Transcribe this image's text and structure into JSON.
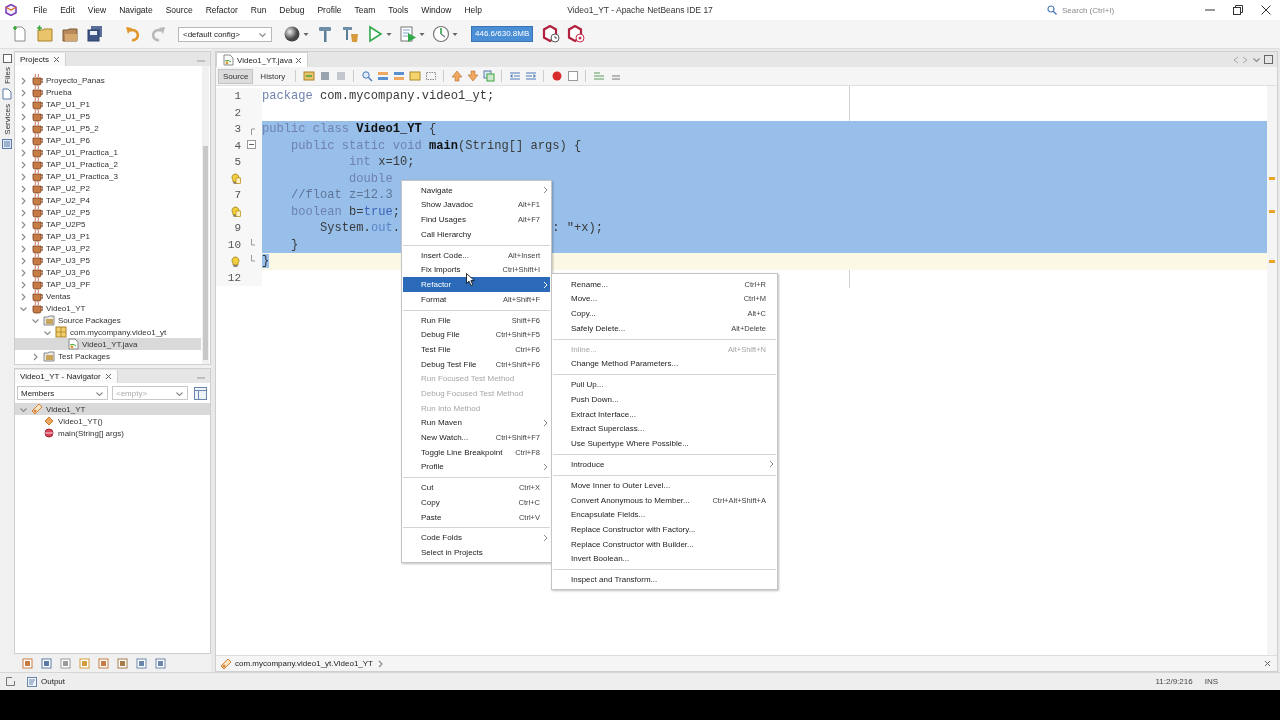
{
  "window": {
    "title": "Video1_YT - Apache NetBeans IDE 17",
    "search": {
      "placeholder": "Search (Ctrl+I)"
    }
  },
  "menu_bar": [
    "File",
    "Edit",
    "View",
    "Navigate",
    "Source",
    "Refactor",
    "Run",
    "Debug",
    "Profile",
    "Team",
    "Tools",
    "Window",
    "Help"
  ],
  "toolbar": {
    "config": "<default config>",
    "memory": "446.6/630.8MB"
  },
  "side_strip": [
    "Files",
    "Services"
  ],
  "projects": {
    "title": "Projects",
    "items": [
      {
        "label": "Proyecto_Panas",
        "kind": "project",
        "expanded": false,
        "selected": false
      },
      {
        "label": "Prueba",
        "kind": "project",
        "expanded": false,
        "selected": false
      },
      {
        "label": "TAP_U1_P1",
        "kind": "project",
        "expanded": false,
        "selected": false
      },
      {
        "label": "TAP_U1_P5",
        "kind": "project",
        "expanded": false,
        "selected": false
      },
      {
        "label": "TAP_U1_P5_2",
        "kind": "project",
        "expanded": false,
        "selected": false
      },
      {
        "label": "TAP_U1_P6",
        "kind": "project",
        "expanded": false,
        "selected": false
      },
      {
        "label": "TAP_U1_Practica_1",
        "kind": "project",
        "expanded": false,
        "selected": false
      },
      {
        "label": "TAP_U1_Practica_2",
        "kind": "project",
        "expanded": false,
        "selected": false
      },
      {
        "label": "TAP_U1_Practica_3",
        "kind": "project",
        "expanded": false,
        "selected": false
      },
      {
        "label": "TAP_U2_P2",
        "kind": "project",
        "expanded": false,
        "selected": false
      },
      {
        "label": "TAP_U2_P4",
        "kind": "project",
        "expanded": false,
        "selected": false
      },
      {
        "label": "TAP_U2_P5",
        "kind": "project",
        "expanded": false,
        "selected": false
      },
      {
        "label": "TAP_U2P5",
        "kind": "project",
        "expanded": false,
        "selected": false
      },
      {
        "label": "TAP_U3_P1",
        "kind": "project",
        "expanded": false,
        "selected": false
      },
      {
        "label": "TAP_U3_P2",
        "kind": "project",
        "expanded": false,
        "selected": false
      },
      {
        "label": "TAP_U3_P5",
        "kind": "project",
        "expanded": false,
        "selected": false
      },
      {
        "label": "TAP_U3_P6",
        "kind": "project",
        "expanded": false,
        "selected": false
      },
      {
        "label": "TAP_U3_PF",
        "kind": "project",
        "expanded": false,
        "selected": false
      },
      {
        "label": "Ventas",
        "kind": "project",
        "expanded": false,
        "selected": false
      },
      {
        "label": "Video1_YT",
        "kind": "project",
        "expanded": true,
        "selected": false,
        "children": [
          {
            "label": "Source Packages",
            "kind": "folder",
            "expanded": true,
            "selected": false,
            "children": [
              {
                "label": "com.mycompany.video1_yt",
                "kind": "package",
                "expanded": true,
                "selected": false,
                "children": [
                  {
                    "label": "Video1_YT.java",
                    "kind": "file",
                    "selected": true
                  }
                ]
              }
            ]
          },
          {
            "label": "Test Packages",
            "kind": "folder",
            "expanded": false,
            "selected": false
          }
        ]
      }
    ]
  },
  "navigator": {
    "title": "Video1_YT - Navigator",
    "filter": "Members",
    "scope": "<empty>",
    "items": [
      {
        "label": "Video1_YT",
        "kind": "class",
        "expanded": true,
        "selected": true,
        "children": [
          {
            "label": "Video1_YT()",
            "kind": "constructor",
            "selected": false
          },
          {
            "label": "main(String[] args)",
            "kind": "method",
            "selected": false
          }
        ]
      }
    ]
  },
  "editor": {
    "tab": "Video1_YT.java",
    "views": [
      {
        "label": "Source",
        "selected": true
      },
      {
        "label": "History",
        "selected": false
      }
    ],
    "lines": [
      {
        "number": "1",
        "warning": false,
        "bulb": false,
        "fold_start": false,
        "fold_toggle": false,
        "fold_end": false,
        "selected": false,
        "current": false,
        "tokens": [
          {
            "kind": "keyword",
            "text": "package "
          },
          {
            "kind": "plain",
            "text": "com.mycompany.video1_yt;"
          }
        ]
      },
      {
        "number": "2",
        "warning": false,
        "bulb": false,
        "fold_start": false,
        "fold_toggle": false,
        "fold_end": false,
        "selected": false,
        "current": false
      },
      {
        "number": "3",
        "warning": false,
        "bulb": false,
        "fold_start": true,
        "fold_toggle": false,
        "fold_end": false,
        "selected": true,
        "current": false,
        "tokens": [
          {
            "kind": "keyword",
            "text": "public class "
          },
          {
            "kind": "name",
            "text": "Video1_YT"
          },
          {
            "kind": "plain",
            "text": " {"
          }
        ]
      },
      {
        "number": "4",
        "warning": false,
        "bulb": false,
        "fold_start": false,
        "fold_toggle": true,
        "fold_end": false,
        "selected": true,
        "current": false,
        "tokens": [
          {
            "kind": "keyword",
            "text": "    public static void "
          },
          {
            "kind": "name",
            "text": "main"
          },
          {
            "kind": "plain",
            "text": "(String[] args) {"
          }
        ]
      },
      {
        "number": "5",
        "warning": false,
        "bulb": false,
        "fold_start": false,
        "fold_toggle": false,
        "fold_end": false,
        "selected": true,
        "current": false,
        "tokens": [
          {
            "kind": "keyword",
            "text": "            int"
          },
          {
            "kind": "plain",
            "text": " x=10;"
          }
        ]
      },
      {
        "warning": true,
        "bulb": false,
        "fold_start": false,
        "fold_toggle": false,
        "fold_end": false,
        "selected": true,
        "current": false,
        "tokens": [
          {
            "kind": "keyword",
            "text": "            double"
          }
        ]
      },
      {
        "number": "7",
        "warning": false,
        "bulb": false,
        "fold_start": false,
        "fold_toggle": false,
        "fold_end": false,
        "selected": true,
        "current": false,
        "tokens": [
          {
            "kind": "comment",
            "text": "    //float z=12.3"
          }
        ]
      },
      {
        "warning": true,
        "bulb": false,
        "fold_start": false,
        "fold_toggle": false,
        "fold_end": false,
        "selected": true,
        "current": false,
        "tokens": [
          {
            "kind": "keyword",
            "text": "    boolean"
          },
          {
            "kind": "plain",
            "text": " b="
          },
          {
            "kind": "literal",
            "text": "true"
          },
          {
            "kind": "plain",
            "text": ";"
          }
        ]
      },
      {
        "number": "9",
        "warning": false,
        "bulb": false,
        "fold_start": false,
        "fold_toggle": false,
        "fold_end": false,
        "selected": true,
        "current": false,
        "tokens": [
          {
            "kind": "plain",
            "text": "        System."
          },
          {
            "kind": "field",
            "text": "out"
          },
          {
            "kind": "plain",
            "text": "."
          }
        ],
        "fragment": [
          {
            "kind": "plain",
            "text": ": \"+x);"
          }
        ]
      },
      {
        "number": "10",
        "warning": false,
        "bulb": false,
        "fold_start": false,
        "fold_toggle": false,
        "fold_end": true,
        "selected": true,
        "current": false,
        "tokens": [
          {
            "kind": "plain",
            "text": "    }"
          }
        ]
      },
      {
        "warning": false,
        "bulb": true,
        "fold_start": false,
        "fold_toggle": false,
        "fold_end": true,
        "selected": false,
        "current": true,
        "tokens": [
          {
            "kind": "selected",
            "text": "}"
          }
        ]
      },
      {
        "number": "12",
        "warning": false,
        "bulb": false,
        "fold_start": false,
        "fold_toggle": false,
        "fold_end": false,
        "selected": false,
        "current": false
      }
    ],
    "breadcrumb": "com.mycompany.video1_yt.Video1_YT"
  },
  "context_menu": {
    "items": [
      {
        "kind": "item",
        "label": "Navigate",
        "submenu": true,
        "disabled": false,
        "selected": false
      },
      {
        "kind": "item",
        "label": "Show Javadoc",
        "shortcut": "Alt+F1",
        "submenu": false,
        "disabled": false,
        "selected": false
      },
      {
        "kind": "item",
        "label": "Find Usages",
        "shortcut": "Alt+F7",
        "submenu": false,
        "disabled": false,
        "selected": false
      },
      {
        "kind": "item",
        "label": "Call Hierarchy",
        "submenu": false,
        "disabled": false,
        "selected": false
      },
      {
        "kind": "separator"
      },
      {
        "kind": "item",
        "label": "Insert Code...",
        "shortcut": "Alt+Insert",
        "submenu": false,
        "disabled": false,
        "selected": false
      },
      {
        "kind": "item",
        "label": "Fix Imports",
        "shortcut": "Ctrl+Shift+I",
        "submenu": false,
        "disabled": false,
        "selected": false
      },
      {
        "kind": "item",
        "label": "Refactor",
        "submenu": true,
        "disabled": false,
        "selected": true
      },
      {
        "kind": "item",
        "label": "Format",
        "shortcut": "Alt+Shift+F",
        "submenu": false,
        "disabled": false,
        "selected": false
      },
      {
        "kind": "separator"
      },
      {
        "kind": "item",
        "label": "Run File",
        "shortcut": "Shift+F6",
        "submenu": false,
        "disabled": false,
        "selected": false
      },
      {
        "kind": "item",
        "label": "Debug File",
        "shortcut": "Ctrl+Shift+F5",
        "submenu": false,
        "disabled": false,
        "selected": false
      },
      {
        "kind": "item",
        "label": "Test File",
        "shortcut": "Ctrl+F6",
        "submenu": false,
        "disabled": false,
        "selected": false
      },
      {
        "kind": "item",
        "label": "Debug Test File",
        "shortcut": "Ctrl+Shift+F6",
        "submenu": false,
        "disabled": false,
        "selected": false
      },
      {
        "kind": "item",
        "label": "Run Focused Test Method",
        "submenu": false,
        "disabled": true,
        "selected": false
      },
      {
        "kind": "item",
        "label": "Debug Focused Test Method",
        "submenu": false,
        "disabled": true,
        "selected": false
      },
      {
        "kind": "item",
        "label": "Run Into Method",
        "submenu": false,
        "disabled": true,
        "selected": false
      },
      {
        "kind": "item",
        "label": "Run Maven",
        "submenu": true,
        "disabled": false,
        "selected": false
      },
      {
        "kind": "item",
        "label": "New Watch...",
        "shortcut": "Ctrl+Shift+F7",
        "submenu": false,
        "disabled": false,
        "selected": false
      },
      {
        "kind": "item",
        "label": "Toggle Line Breakpoint",
        "shortcut": "Ctrl+F8",
        "submenu": false,
        "disabled": false,
        "selected": false
      },
      {
        "kind": "item",
        "label": "Profile",
        "submenu": true,
        "disabled": false,
        "selected": false
      },
      {
        "kind": "separator"
      },
      {
        "kind": "item",
        "label": "Cut",
        "shortcut": "Ctrl+X",
        "submenu": false,
        "disabled": false,
        "selected": false
      },
      {
        "kind": "item",
        "label": "Copy",
        "shortcut": "Ctrl+C",
        "submenu": false,
        "disabled": false,
        "selected": false
      },
      {
        "kind": "item",
        "label": "Paste",
        "shortcut": "Ctrl+V",
        "submenu": false,
        "disabled": false,
        "selected": false
      },
      {
        "kind": "separator"
      },
      {
        "kind": "item",
        "label": "Code Folds",
        "submenu": true,
        "disabled": false,
        "selected": false
      },
      {
        "kind": "item",
        "label": "Select in Projects",
        "submenu": false,
        "disabled": false,
        "selected": false
      }
    ]
  },
  "refactor_menu": {
    "items": [
      {
        "kind": "item",
        "label": "Rename...",
        "shortcut": "Ctrl+R",
        "submenu": false,
        "disabled": false,
        "selected": false
      },
      {
        "kind": "item",
        "label": "Move...",
        "shortcut": "Ctrl+M",
        "submenu": false,
        "disabled": false,
        "selected": false
      },
      {
        "kind": "item",
        "label": "Copy...",
        "shortcut": "Alt+C",
        "submenu": false,
        "disabled": false,
        "selected": false
      },
      {
        "kind": "item",
        "label": "Safely Delete...",
        "shortcut": "Alt+Delete",
        "submenu": false,
        "disabled": false,
        "selected": false
      },
      {
        "kind": "separator"
      },
      {
        "kind": "item",
        "label": "Inline...",
        "shortcut": "Alt+Shift+N",
        "submenu": false,
        "disabled": true,
        "selected": false
      },
      {
        "kind": "item",
        "label": "Change Method Parameters...",
        "submenu": false,
        "disabled": false,
        "selected": false
      },
      {
        "kind": "separator"
      },
      {
        "kind": "item",
        "label": "Pull Up...",
        "submenu": false,
        "disabled": false,
        "selected": false
      },
      {
        "kind": "item",
        "label": "Push Down...",
        "submenu": false,
        "disabled": false,
        "selected": false
      },
      {
        "kind": "item",
        "label": "Extract Interface...",
        "submenu": false,
        "disabled": false,
        "selected": false
      },
      {
        "kind": "item",
        "label": "Extract Superclass...",
        "submenu": false,
        "disabled": false,
        "selected": false
      },
      {
        "kind": "item",
        "label": "Use Supertype Where Possible...",
        "submenu": false,
        "disabled": false,
        "selected": false
      },
      {
        "kind": "separator"
      },
      {
        "kind": "item",
        "label": "Introduce",
        "submenu": true,
        "disabled": false,
        "selected": false
      },
      {
        "kind": "separator"
      },
      {
        "kind": "item",
        "label": "Move Inner to Outer Level...",
        "submenu": false,
        "disabled": false,
        "selected": false
      },
      {
        "kind": "item",
        "label": "Convert Anonymous to Member...",
        "shortcut": "Ctrl+Alt+Shift+A",
        "submenu": false,
        "disabled": false,
        "selected": false
      },
      {
        "kind": "item",
        "label": "Encapsulate Fields...",
        "submenu": false,
        "disabled": false,
        "selected": false
      },
      {
        "kind": "item",
        "label": "Replace Constructor with Factory...",
        "submenu": false,
        "disabled": false,
        "selected": false
      },
      {
        "kind": "item",
        "label": "Replace Constructor with Builder...",
        "submenu": false,
        "disabled": false,
        "selected": false
      },
      {
        "kind": "item",
        "label": "Invert Boolean...",
        "submenu": false,
        "disabled": false,
        "selected": false
      },
      {
        "kind": "separator"
      },
      {
        "kind": "item",
        "label": "Inspect and Transform...",
        "submenu": false,
        "disabled": false,
        "selected": false
      }
    ]
  },
  "status_bar": {
    "output": "Output",
    "position": "11:2/9:216",
    "mode": "INS"
  }
}
